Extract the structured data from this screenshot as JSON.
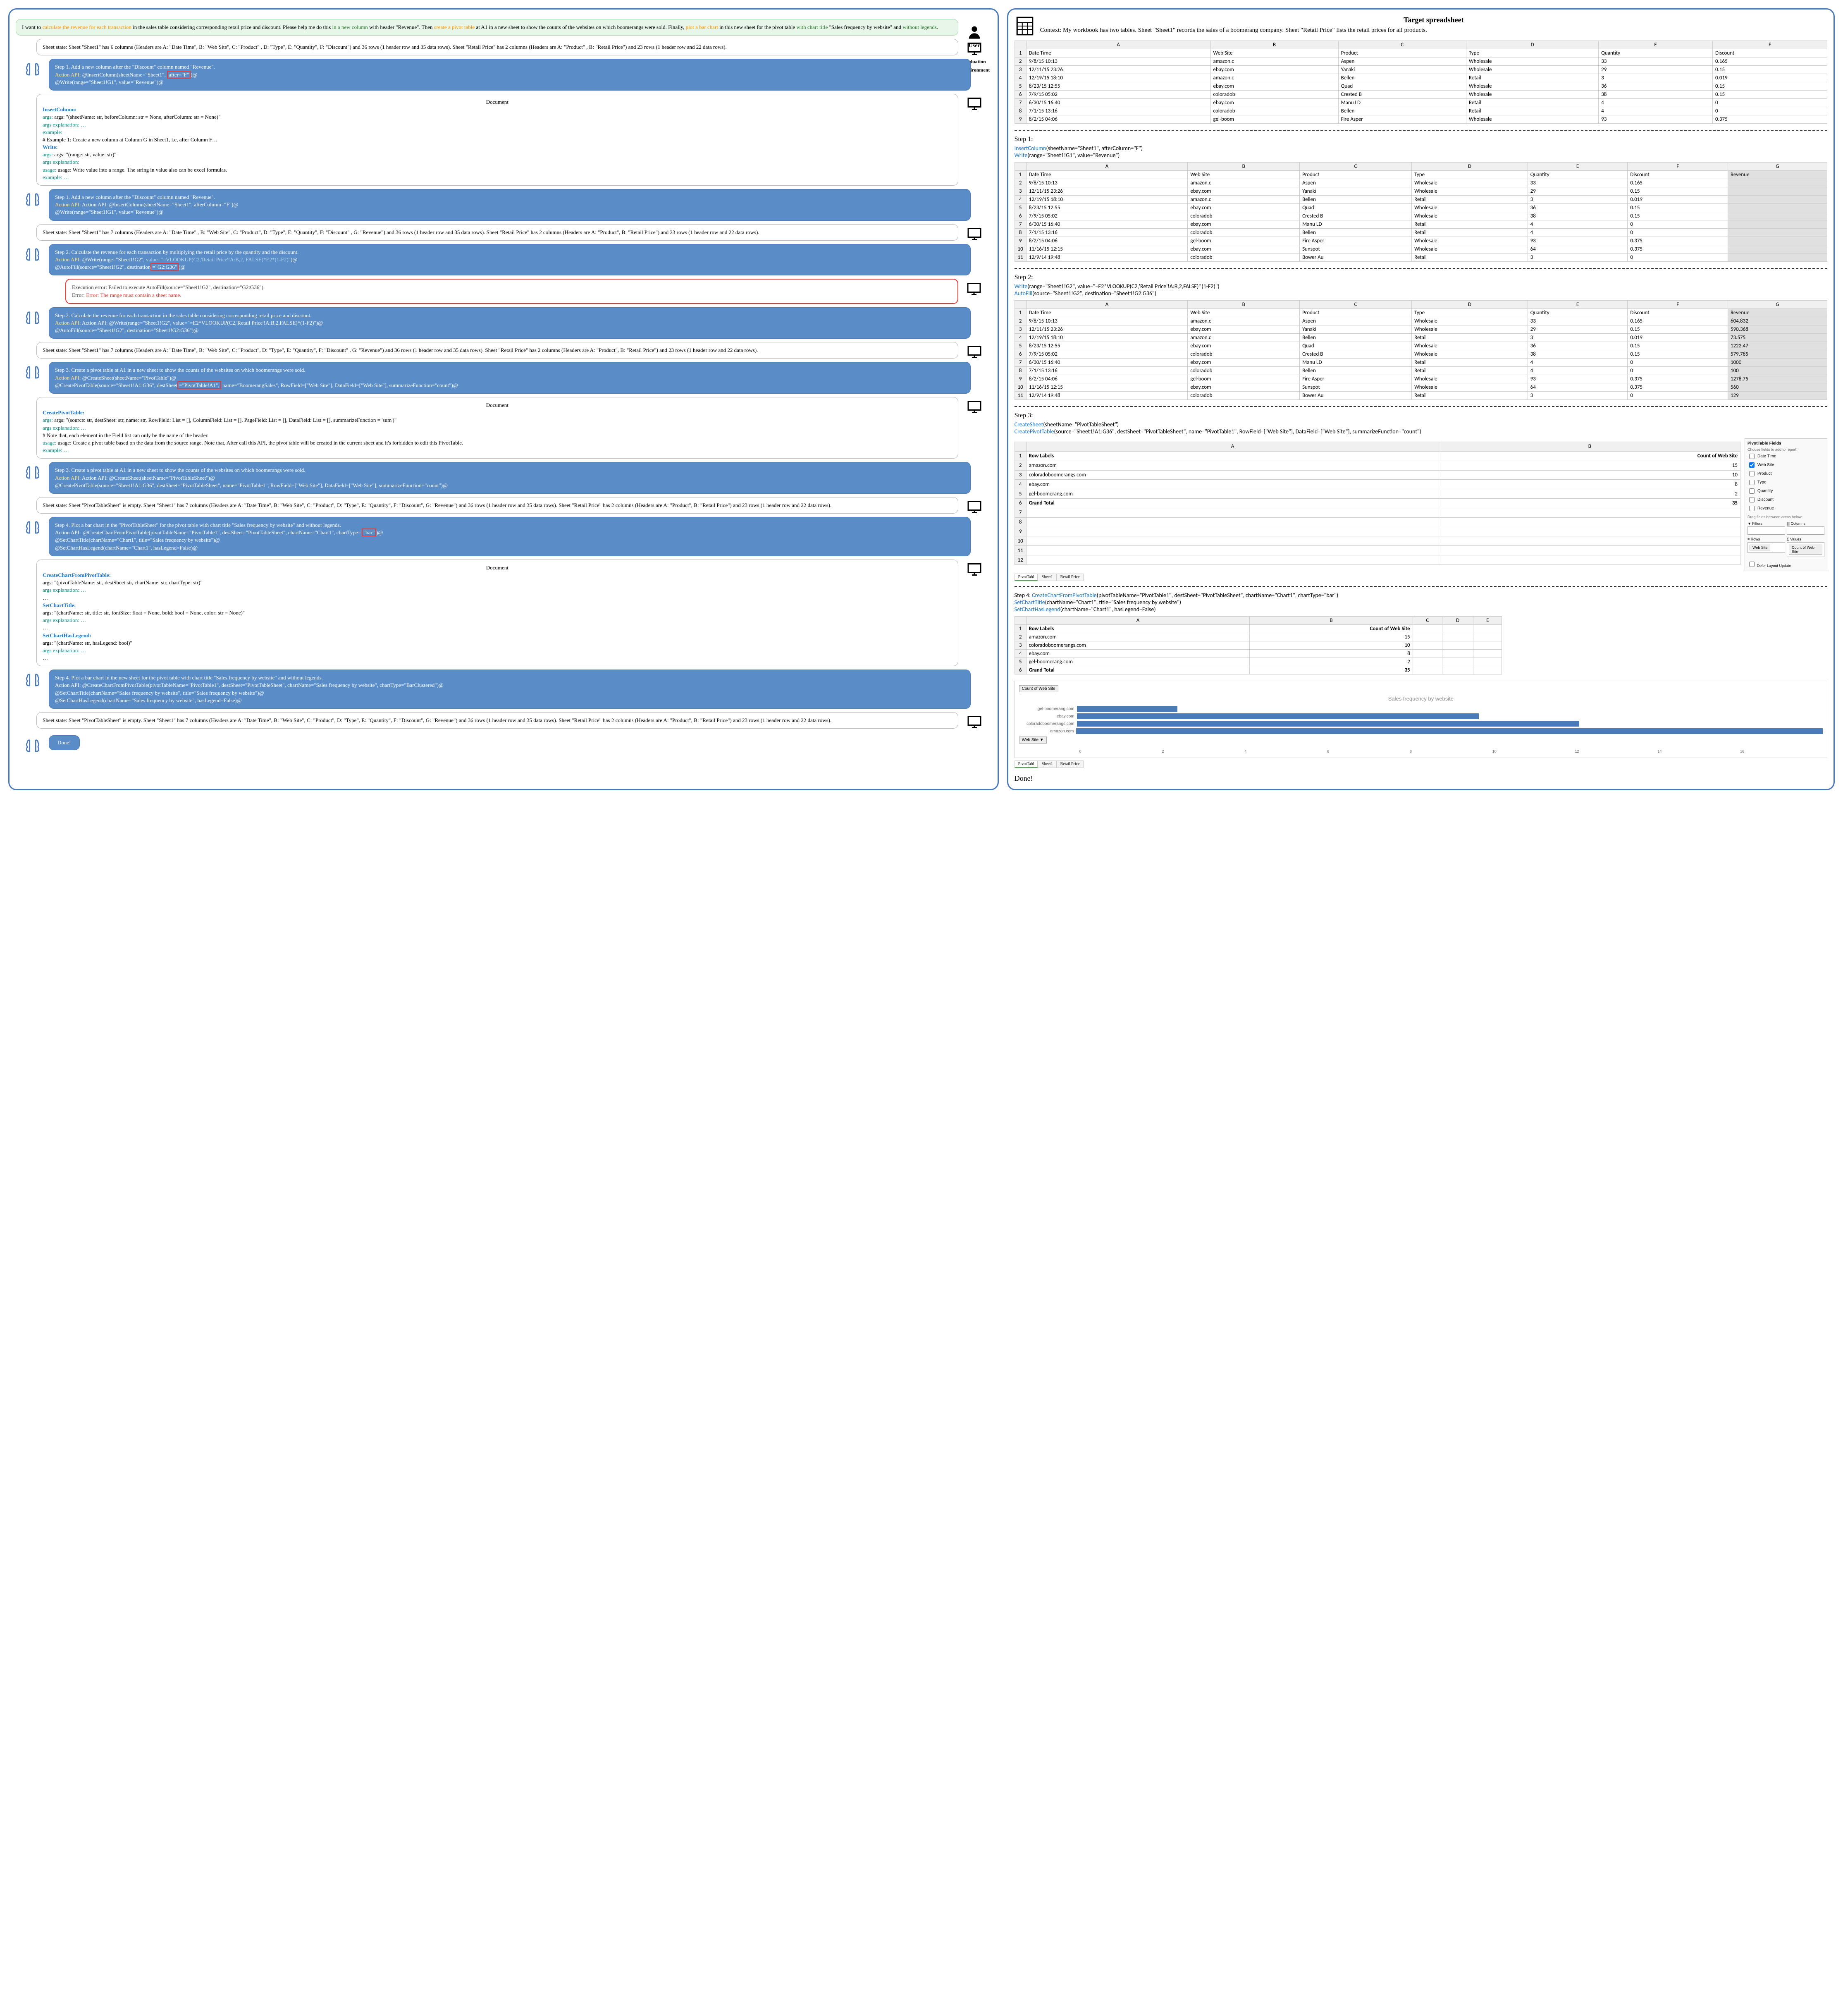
{
  "labels": {
    "user": "User",
    "env": "Evaluation\nEnvironment",
    "copilot": "Sheet\nCopilot",
    "doc": "Document",
    "done": "Done!",
    "target": "Target spreadsheet"
  },
  "user_request": {
    "p1a": "I want to ",
    "p1b": "calculate the revenue for each transaction",
    "p1c": " in the sales table considering corresponding retail price and discount. Please help me do this ",
    "p1d": "in a new column",
    "p1e": " with header \"Revenue\". Then ",
    "p1f": "create a pivot table",
    "p1g": " at A1 in a new sheet to show the counts of the websites on which boomerangs were sold. Finally, ",
    "p1h": "plot a bar chart",
    "p1i": " in this new sheet for the pivot table ",
    "p1j": "with chart title",
    "p1k": " \"Sales frequency by website\" and ",
    "p1l": "without legends",
    "p1m": "."
  },
  "env1": "Sheet state: Sheet \"Sheet1\" has 6 columns (Headers are A: \"Date Time\", B: \"Web Site\", C: \"Product\" , D: \"Type\", E: \"Quantity\", F: \"Discount\") and 36 rows (1 header row and 35 data rows). Sheet \"Retail Price\" has 2 columns (Headers are A: \"Product\" , B: \"Retail Price\") and 23 rows (1 header row and 22 data rows).",
  "cp1": {
    "t1": "Step 1. Add a new column after the \"Discount\" column named \"Revenue\".",
    "t2a": "Action API:",
    "t2b": " @InsertColumn(sheetName=\"Sheet1\", ",
    "t2c": "after=\"F\"",
    "t2d": ")@",
    "t3": "@Write(range=\"Sheet1!G1\", value=\"Revenue\")@"
  },
  "doc1": {
    "l1": "InsertColumn:",
    "l2": "args: \"(sheetName: str, beforeColumn: str = None, afterColumn: str = None)\"",
    "l3": "args explanation: …",
    "l4": "example:",
    "l5": "# Example 1: Create a new column at Column G in Sheet1, i.e, after Column F…",
    "l6": "Write:",
    "l7": "args: \"(range: str, value: str)\"",
    "l8": "args explanation:",
    "l9": "usage: Write value into a range. The string in value also can be excel formulas.",
    "l10": "example: …"
  },
  "cp1b": {
    "t1": "Step 1. Add a new column after the \"Discount\" column named \"Revenue\".",
    "t2": "Action API: @InsertColumn(sheetName=\"Sheet1\", afterColumn=\"F\")@",
    "t3": "@Write(range=\"Sheet1!G1\", value=\"Revenue\")@"
  },
  "env2": "Sheet state: Sheet \"Sheet1\" has 7 columns (Headers are A: \"Date Time\" , B: \"Web Site\", C: \"Product\", D: \"Type\", E: \"Quantity\", F: \"Discount\" , G: \"Revenue\") and 36 rows (1 header row and 35 data rows). Sheet \"Retail Price\" has 2 columns (Headers are A: \"Product\", B: \"Retail Price\") and 23 rows (1 header row and 22 data rows).",
  "cp2": {
    "t1": "Step 2. Calculate the revenue for each transaction by multiplying the retail price by the quantity and the discount.",
    "t2a": "Action API:",
    "t2b": " @Write(range=\"Sheet1!G2\", ",
    "t2c": "value=\"=VLOOKUP(C2,'Retail Price'!A:B,2, FALSE)*E2*(1-F2)\"",
    "t2d": ")@",
    "t3a": "@AutoFill(source=\"Sheet1!G2\", destination",
    "t3b": "=\"G2:G36\"",
    "t3c": ")@"
  },
  "err1": {
    "l1": "Execution error: Failed to execute AutoFill(source=\"Sheet1!G2\", destination=\"G2:G36\").",
    "l2": "Error: The range must  contain a sheet name."
  },
  "cp2b": {
    "t1": "Step 2. Calculate the revenue for each transaction in the sales table considering corresponding retail price and discount.",
    "t2": "Action API: @Write(range=\"Sheet1!G2\", value=\"=E2*VLOOKUP(C2,'Retail Price'!A:B,2,FALSE)*(1-F2)\")@",
    "t3": "@AutoFill(source=\"Sheet1!G2\", destination=\"Sheet1!G2:G36\")@"
  },
  "env3": "Sheet state: Sheet \"Sheet1\" has 7 columns (Headers are A: \"Date Time\", B: \"Web Site\", C: \"Product\", D: \"Type\", E: \"Quantity\", F: \"Discount\" , G: \"Revenue\") and 36 rows (1 header row and 35 data rows). Sheet \"Retail Price\" has 2 columns (Headers are A: \"Product\", B: \"Retail Price\") and 23 rows (1 header row and 22 data rows).",
  "cp3": {
    "t1": "Step 3. Create a pivot table at A1 in a new sheet to show the counts of the websites on which boomerangs were sold.",
    "t2a": "Action API:",
    "t2b": " @CreateSheet(sheetName=\"PivotTable\")@",
    "t3a": "@CreatePivotTable(source=\"Sheet1!A1:G36\", destSheet",
    "t3b": "=\"PivotTable!A1\",",
    "t3c": " name=\"BoomerangSales\", RowField=[\"Web Site\"], DataField=[\"Web Site\"], summarizeFunction=\"count\")@"
  },
  "doc2": {
    "l1": "CreatePivotTable:",
    "l2": "args: \"(source: str, destSheet: str, name: str, RowField: List = [], ColumnField: List = [], PageField: List = [], DataField: List = [], summarizeFunction = 'sum')\"",
    "l3": "args explanation: …",
    "l4": "# Note that, each element in the Field list can only be the name of the header.",
    "l5": "usage: Create a pivot table based on the data from the source range. Note that, After call this API, the pivot table will be created in the current sheet and it's forbidden to edit this PivotTable.",
    "l6": "example: …"
  },
  "cp3b": {
    "t1": "Step 3. Create a pivot table at A1 in a new sheet to show the counts of the websites on which boomerangs were sold.",
    "t2": "Action API: @CreateSheet(sheetName=\"PivotTableSheet\")@",
    "t3": "@CreatePivotTable(source=\"Sheet1!A1:G36\", destSheet=\"PivotTableSheet\", name=\"PivotTable1\", RowField=[\"Web Site\"], DataField=[\"Web Site\"], summarizeFunction=\"count\")@"
  },
  "env4": "Sheet state: Sheet \"PivotTableSheet\" is empty. Sheet \"Sheet1\" has 7 columns (Headers are A: \"Date Time\", B: \"Web Site\", C: \"Product\", D: \"Type\", E: \"Quantity\", F: \"Discount\", G: \"Revenue\") and 36 rows (1 header row and 35 data rows). Sheet \"Retail Price\" has 2 columns (Headers are A: \"Product\", B: \"Retail Price\") and 23 rows (1 header row and 22 data rows).",
  "cp4": {
    "t1": "Step 4. Plot a bar chart in the \"PivotTableSheet\" for the pivot table with chart title \"Sales frequency by website\" and without legends.",
    "t2a": "Action API: ",
    "t2b": "@CreateChartFromPivotTable(pivotTableName=\"PivotTable1\", destSheet=\"PivotTableSheet\", chartName=\"Chart1\", chartType=",
    "t2c": "\"bar\"",
    "t2d": ")@",
    "t3": "@SetChartTitle(chartName=\"Chart1\", title=\"Sales frequency by website\")@",
    "t4": "@SetChartHasLegend(chartName=\"Chart1\", hasLegend=False)@"
  },
  "doc3": {
    "l1": "CreateChartFromPivotTable:",
    "l2": "args: \"(pivotTableName: str, destSheet:str, chartName: str, chartType: str)\"",
    "l3": "args explanation: …",
    "l4": "…",
    "l5": "SetChartTitle:",
    "l6": "args: \"(chartName: str, title: str, fontSize: float = None, bold: bool = None, color: str = None)\"",
    "l7": "args explanation: …",
    "l8": "…",
    "l9": "SetChartHasLegend:",
    "l10": "args: \"(chartName: str, hasLegend: bool)\"",
    "l11": "args explanation: …",
    "l12": "…"
  },
  "cp4b": {
    "t1": "Step 4. Plot a bar chart in the new sheet for the pivot table with chart title \"Sales frequency by website\" and without legends.",
    "t2": "Action API: @CreateChartFromPivotTable(pivotTableName=\"PivotTable1\", destSheet=\"PivotTableSheet\", chartName=\"Sales frequency by website\", chartType=\"BarClustered\")@",
    "t3": "@SetChartTitle(chartName=\"Sales frequency by website\", title=\"Sales frequency by website\")@",
    "t4": "@SetChartHasLegend(chartName=\"Sales frequency by website\", hasLegend=False)@"
  },
  "env5": "Sheet state: Sheet \"PivotTableSheet\"  is empty. Sheet \"Sheet1\" has 7 columns (Headers are A: \"Date Time\", B: \"Web Site\", C: \"Product\", D: \"Type\", E: \"Quantity\", F: \"Discount\", G: \"Revenue\") and 36 rows (1 header row and 35 data rows). Sheet \"Retail Price\" has 2 columns (Headers are A: \"Product\", B: \"Retail Price\") and 23 rows (1 header row and 22 data rows).",
  "right": {
    "context": "Context: My workbook has two tables. Sheet \"Sheet1\" records the sales of a boomerang company. Sheet \"Retail Price\" lists the retail prices for all products.",
    "t1_headers": [
      "",
      "A",
      "B",
      "C",
      "D",
      "E",
      "F"
    ],
    "t1_colhdr": [
      "Date Time",
      "Web Site",
      "Product",
      "Type",
      "Quantity",
      "Discount"
    ],
    "t1_rows": [
      [
        "2",
        "9/8/15 10:13",
        "amazon.c",
        "Aspen",
        "Wholesale",
        "33",
        "0.165"
      ],
      [
        "3",
        "12/11/15 23:26",
        "ebay.com",
        "Yanaki",
        "Wholesale",
        "29",
        "0.15"
      ],
      [
        "4",
        "12/19/15 18:10",
        "amazon.c",
        "Bellen",
        "Retail",
        "3",
        "0.019"
      ],
      [
        "5",
        "8/23/15 12:55",
        "ebay.com",
        "Quad",
        "Wholesale",
        "36",
        "0.15"
      ],
      [
        "6",
        "7/9/15 05:02",
        "coloradob",
        "Crested B",
        "Wholesale",
        "38",
        "0.15"
      ],
      [
        "7",
        "6/30/15 16:40",
        "ebay.com",
        "Manu LD",
        "Retail",
        "4",
        "0"
      ],
      [
        "8",
        "7/1/15 13:16",
        "coloradob",
        "Bellen",
        "Retail",
        "4",
        "0"
      ],
      [
        "9",
        "8/2/15 04:06",
        "gel-boom",
        "Fire Asper",
        "Wholesale",
        "93",
        "0.375"
      ]
    ],
    "step1_l1": "Step 1:",
    "step1_c1a": "InsertColumn",
    "step1_c1b": "(sheetName=\"Sheet1\", afterColumn=\"F\")",
    "step1_c2a": "Write",
    "step1_c2b": "(range=\"Sheet1!G1\", value=\"Revenue\")",
    "t2_headers": [
      "",
      "A",
      "B",
      "C",
      "D",
      "E",
      "F",
      "G"
    ],
    "t2_colhdr": [
      "Date Time",
      "Web Site",
      "Product",
      "Type",
      "Quantity",
      "Discount",
      "Revenue"
    ],
    "t2_rows": [
      [
        "2",
        "9/8/15 10:13",
        "amazon.c",
        "Aspen",
        "Wholesale",
        "33",
        "0.165",
        ""
      ],
      [
        "3",
        "12/11/15 23:26",
        "ebay.com",
        "Yanaki",
        "Wholesale",
        "29",
        "0.15",
        ""
      ],
      [
        "4",
        "12/19/15 18:10",
        "amazon.c",
        "Bellen",
        "Retail",
        "3",
        "0.019",
        ""
      ],
      [
        "5",
        "8/23/15 12:55",
        "ebay.com",
        "Quad",
        "Wholesale",
        "36",
        "0.15",
        ""
      ],
      [
        "6",
        "7/9/15 05:02",
        "coloradob",
        "Crested B",
        "Wholesale",
        "38",
        "0.15",
        ""
      ],
      [
        "7",
        "6/30/15 16:40",
        "ebay.com",
        "Manu LD",
        "Retail",
        "4",
        "0",
        ""
      ],
      [
        "8",
        "7/1/15 13:16",
        "coloradob",
        "Bellen",
        "Retail",
        "4",
        "0",
        ""
      ],
      [
        "9",
        "8/2/15 04:06",
        "gel-boom",
        "Fire Asper",
        "Wholesale",
        "93",
        "0.375",
        ""
      ],
      [
        "10",
        "11/16/15 12:15",
        "ebay.com",
        "Sunspot",
        "Wholesale",
        "64",
        "0.375",
        ""
      ],
      [
        "11",
        "12/9/14 19:48",
        "coloradob",
        "Bower Au",
        "Retail",
        "3",
        "0",
        ""
      ]
    ],
    "step2_l1": "Step 2:",
    "step2_c1a": "Write",
    "step2_c1b": "(range=\"Sheet1!G2\", value=\"=E2*VLOOKUP(C2,'Retail Price'!A:B,2,FALSE)*(1-F2)\")",
    "step2_c2a": "AutoFill",
    "step2_c2b": "(source=\"Sheet1!G2\", destination=\"Sheet1!G2:G36\")",
    "t3_rows": [
      [
        "2",
        "9/8/15 10:13",
        "amazon.c",
        "Aspen",
        "Wholesale",
        "33",
        "0.165",
        "604.832"
      ],
      [
        "3",
        "12/11/15 23:26",
        "ebay.com",
        "Yanaki",
        "Wholesale",
        "29",
        "0.15",
        "590.368"
      ],
      [
        "4",
        "12/19/15 18:10",
        "amazon.c",
        "Bellen",
        "Retail",
        "3",
        "0.019",
        "73.575"
      ],
      [
        "5",
        "8/23/15 12:55",
        "ebay.com",
        "Quad",
        "Wholesale",
        "36",
        "0.15",
        "1222.47"
      ],
      [
        "6",
        "7/9/15 05:02",
        "coloradob",
        "Crested B",
        "Wholesale",
        "38",
        "0.15",
        "579.785"
      ],
      [
        "7",
        "6/30/15 16:40",
        "ebay.com",
        "Manu LD",
        "Retail",
        "4",
        "0",
        "1000"
      ],
      [
        "8",
        "7/1/15 13:16",
        "coloradob",
        "Bellen",
        "Retail",
        "4",
        "0",
        "100"
      ],
      [
        "9",
        "8/2/15 04:06",
        "gel-boom",
        "Fire Asper",
        "Wholesale",
        "93",
        "0.375",
        "1278.75"
      ],
      [
        "10",
        "11/16/15 12:15",
        "ebay.com",
        "Sunspot",
        "Wholesale",
        "64",
        "0.375",
        "560"
      ],
      [
        "11",
        "12/9/14 19:48",
        "coloradob",
        "Bower Au",
        "Retail",
        "3",
        "0",
        "129"
      ]
    ],
    "step3_l1": "Step 3:",
    "step3_c1a": "CreateSheet",
    "step3_c1b": "(sheetName=\"PivotTableSheet\")",
    "step3_c2a": "CreatePivotTable",
    "step3_c2b": "(source=\"Sheet1!A1:G36\", destSheet=\"PivotTableSheet\", name=\"PivotTable1\", RowField=[\"Web Site\"], DataField=[\"Web Site\"], summarizeFunction=\"count\")",
    "pivot_rows": [
      [
        "1",
        "Row Labels",
        "Count of Web Site"
      ],
      [
        "2",
        "amazon.com",
        "15"
      ],
      [
        "3",
        "coloradoboomerangs.com",
        "10"
      ],
      [
        "4",
        "ebay.com",
        "8"
      ],
      [
        "5",
        "gel-boomerang.com",
        "2"
      ],
      [
        "6",
        "Grand Total",
        "35"
      ]
    ],
    "pf": {
      "title": "PivotTable Fields",
      "sub": "Choose fields to add to report:",
      "fields": [
        "Date Time",
        "Web Site",
        "Product",
        "Type",
        "Quantity",
        "Discount",
        "Revenue"
      ],
      "checked": [
        "Web Site"
      ],
      "drag": "Drag fields between areas below:",
      "filters": "▼ Filters",
      "cols": "||| Columns",
      "rows": "≡ Rows",
      "vals": "Σ Values",
      "row_item": "Web Site",
      "val_item": "Count of Web Site",
      "defer": "Defer Layout Update"
    },
    "tabs": [
      "PivotTabl",
      "Sheet1",
      "Retail Price"
    ],
    "step4_l1": "Step 4: ",
    "step4_c1a": "CreateChartFromPivotTable",
    "step4_c1b": "(pivotTableName=\"PivotTable1\", destSheet=\"PivotTableSheet\", chartName=\"Chart1\", chartType=\"bar\")",
    "step4_c2a": "SetChartTitle",
    "step4_c2b": "(chartName=\"Chart1\", title=\"Sales frequency by website\")",
    "step4_c3a": "SetChartHasLegend",
    "step4_c3b": "(chartName=\"Chart1\", hasLegend=False)",
    "chart_btn1": "Count of Web Site",
    "chart_btn2": "Web Site ▼",
    "chart_title": "Sales frequency by website"
  },
  "chart_data": {
    "type": "bar",
    "orientation": "horizontal",
    "title": "Sales frequency by website",
    "xlabel": "",
    "ylabel": "",
    "legend": false,
    "xlim": [
      0,
      16
    ],
    "xticks": [
      0,
      2,
      4,
      6,
      8,
      10,
      12,
      14,
      16
    ],
    "categories": [
      "gel-boomerang.com",
      "ebay.com",
      "coloradoboomerangs.com",
      "amazon.com"
    ],
    "values": [
      2,
      8,
      10,
      15
    ]
  }
}
